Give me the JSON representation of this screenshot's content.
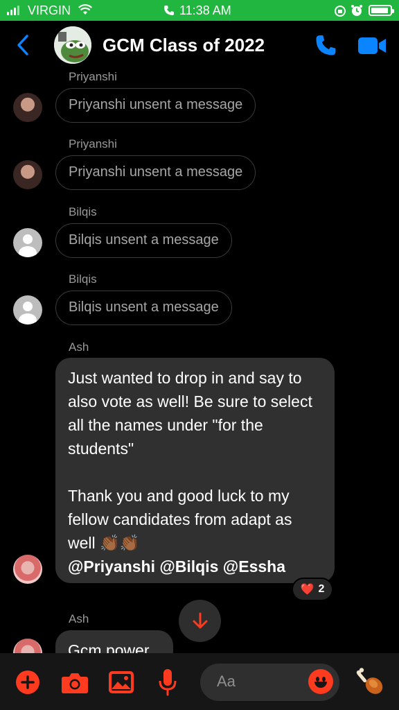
{
  "status_bar": {
    "carrier": "VIRGIN",
    "time": "11:38 AM"
  },
  "header": {
    "title": "GCM Class of 2022"
  },
  "messages": [
    {
      "sender": "Priyanshi",
      "text": "Priyanshi unsent a message"
    },
    {
      "sender": "Priyanshi",
      "text": "Priyanshi unsent a message"
    },
    {
      "sender": "Bilqis",
      "text": "Bilqis unsent a message"
    },
    {
      "sender": "Bilqis",
      "text": "Bilqis unsent a message"
    },
    {
      "sender": "Ash",
      "paragraph1": "Just wanted to drop in and say to also vote as well! Be sure to select all the names under \"for the students\"",
      "paragraph2": "Thank you and good luck to my fellow candidates from adapt as well 👏🏾👏🏾",
      "mentions": "@Priyanshi @Bilqis @Essha",
      "reaction": {
        "emoji": "❤️",
        "count": "2"
      }
    },
    {
      "sender": "Ash",
      "text": "Gcm power"
    }
  ],
  "composer": {
    "placeholder": "Aa"
  },
  "colors": {
    "accent_blue": "#0a84ff",
    "accent_red": "#ff3b1f",
    "status_green": "#21b63f"
  },
  "icons": [
    "back-chevron-icon",
    "phone-icon",
    "video-camera-icon",
    "plus-icon",
    "camera-icon",
    "gallery-icon",
    "microphone-icon",
    "emoji-icon",
    "drumstick-icon",
    "arrow-down-icon"
  ]
}
